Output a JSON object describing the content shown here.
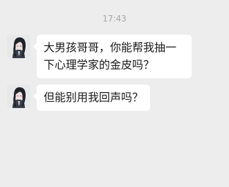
{
  "chat": {
    "timestamp": "17:43",
    "messages": [
      {
        "sender": "incoming",
        "avatar_icon": "dark-haired-character-avatar",
        "text": "大男孩哥哥，你能帮我抽一下心理学家的金皮吗？"
      },
      {
        "sender": "incoming",
        "avatar_icon": "dark-haired-character-avatar",
        "text": "但能别用我回声吗？"
      }
    ]
  },
  "colors": {
    "background": "#ededed",
    "bubble": "#ffffff",
    "text": "#191919",
    "timestamp": "#a6a6a6"
  }
}
